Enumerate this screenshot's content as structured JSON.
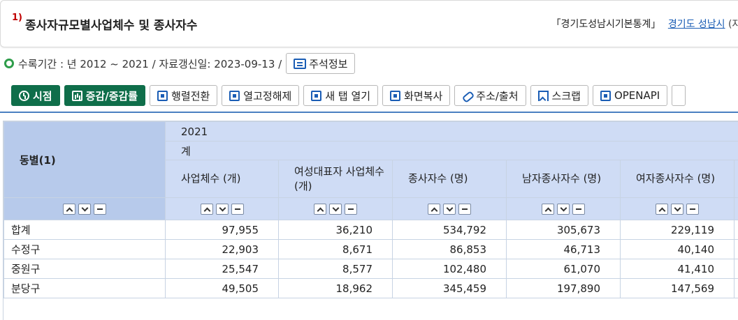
{
  "header": {
    "number": "1)",
    "title": "종사자규모별사업체수 및 종사자수",
    "source_prefix": "「경기도성남시기본통계」",
    "source_link": "경기도 성남시",
    "source_tail": "(자료문의"
  },
  "period": {
    "text": "수록기간 : 년 2012 ~ 2021 / 자료갱신일: 2023-09-13 /",
    "note_button": "주석정보"
  },
  "toolbar": {
    "time": "시점",
    "change": "증감/증감률",
    "transpose": "행렬전환",
    "fix": "열고정해제",
    "new_tab": "새 탭 열기",
    "copy": "화면복사",
    "address": "주소/출처",
    "scrap": "스크랩",
    "openapi": "OPENAPI"
  },
  "table": {
    "row_header": "동별(1)",
    "year": "2021",
    "sub": "계",
    "columns": [
      "사업체수 (개)",
      "여성대표자 사업체수 (개)",
      "종사자수 (명)",
      "남자종사자수 (명)",
      "여자종사자수 (명)"
    ],
    "rows": [
      {
        "label": "합계",
        "values": [
          "97,955",
          "36,210",
          "534,792",
          "305,673",
          "229,119"
        ]
      },
      {
        "label": "수정구",
        "values": [
          "22,903",
          "8,671",
          "86,853",
          "46,713",
          "40,140"
        ]
      },
      {
        "label": "중원구",
        "values": [
          "25,547",
          "8,577",
          "102,480",
          "61,070",
          "41,410"
        ]
      },
      {
        "label": "분당구",
        "values": [
          "49,505",
          "18,962",
          "345,459",
          "197,890",
          "147,569"
        ]
      }
    ]
  },
  "colors": {
    "accent_green": "#0f6e4a",
    "header_blue": "#cfdcf5",
    "link_blue": "#1a5db5"
  }
}
